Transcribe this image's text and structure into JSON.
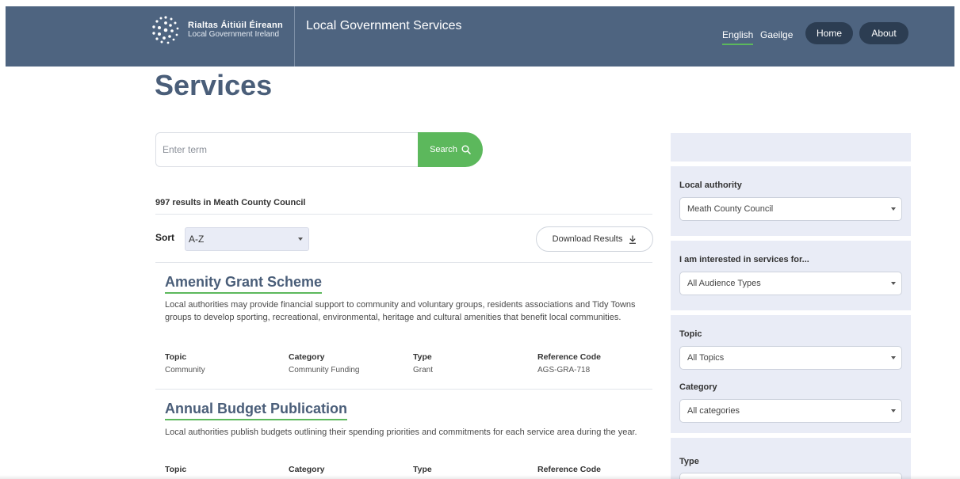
{
  "header": {
    "brand_irish": "Rialtas Áitiúil Éireann",
    "brand_english": "Local Government Ireland",
    "site_title": "Local Government Services",
    "languages": [
      "English",
      "Gaeilge"
    ],
    "nav": [
      "Home",
      "About"
    ],
    "logo_icon": "dotted-circle-logo",
    "background_color": "#4e6480",
    "pill_color": "#2c3d52"
  },
  "page": {
    "title": "Services"
  },
  "search": {
    "placeholder": "Enter term",
    "value": "",
    "button_label": "Search",
    "button_icon": "search-icon",
    "button_color": "#5cb85c"
  },
  "results": {
    "summary": "997 results in Meath County Council",
    "sort_label": "Sort",
    "sort_value": "A-Z",
    "download_label": "Download Results",
    "download_icon": "download-arrow-icon",
    "meta_labels": [
      "Topic",
      "Category",
      "Type",
      "Reference Code"
    ],
    "items": [
      {
        "title": "Amenity Grant Scheme",
        "description": "Local authorities may provide financial support to community and voluntary groups, residents associations and Tidy Towns groups to develop sporting, recreational, environmental, heritage and cultural amenities that benefit local communities.",
        "topic": "Community",
        "category": "Community Funding",
        "type": "Grant",
        "reference_code": "AGS-GRA-718"
      },
      {
        "title": "Annual Budget Publication",
        "description": "Local authorities publish budgets outlining their spending priorities and commitments for each service area during the year."
      }
    ]
  },
  "filters": {
    "local_authority_label": "Local authority",
    "local_authority_value": "Meath County Council",
    "audience_label": "I am interested in services for...",
    "audience_value": "All Audience Types",
    "topic_label": "Topic",
    "topic_value": "All Topics",
    "category_label": "Category",
    "category_value": "All categories",
    "type_label": "Type",
    "panel_color": "#e9ecf6"
  }
}
